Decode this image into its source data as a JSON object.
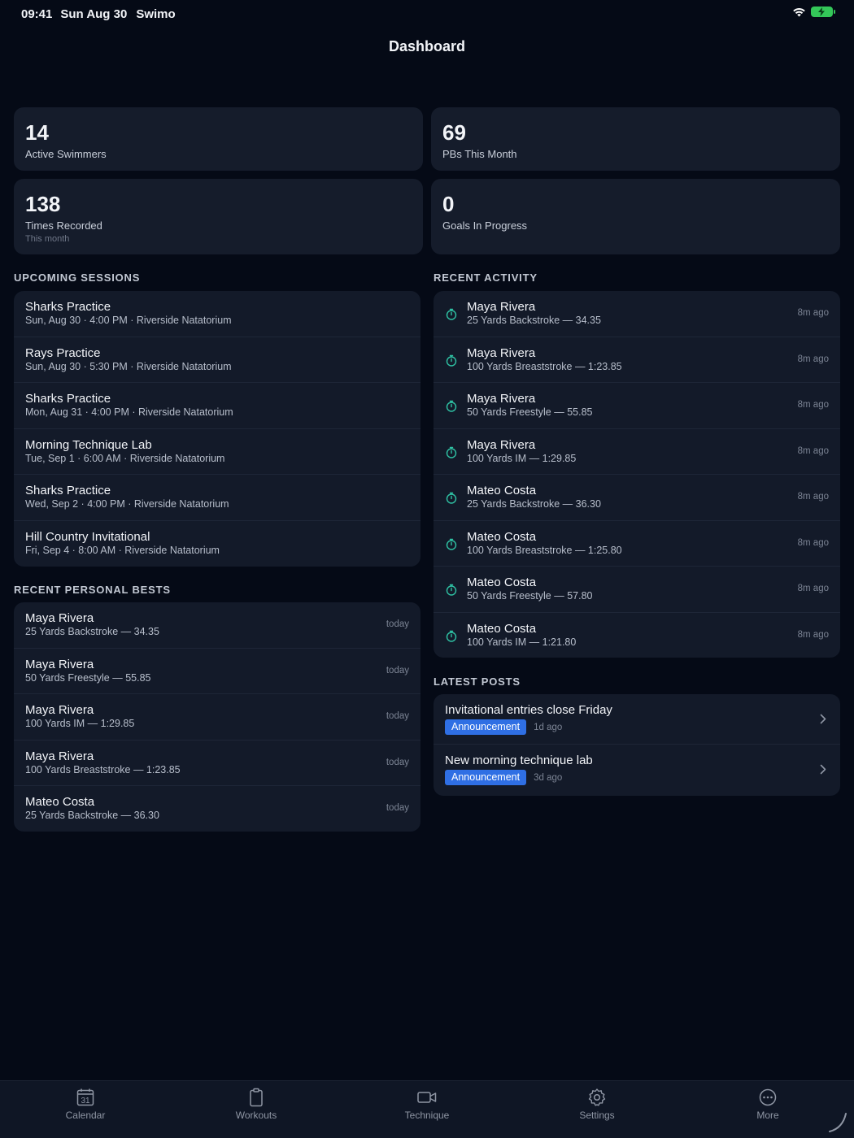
{
  "status_bar": {
    "time": "09:41",
    "date": "Sun Aug 30",
    "app_name": "Swimo"
  },
  "page": {
    "title": "Dashboard"
  },
  "stats": [
    {
      "value": "14",
      "label": "Active Swimmers",
      "sub": ""
    },
    {
      "value": "69",
      "label": "PBs This Month",
      "sub": ""
    },
    {
      "value": "138",
      "label": "Times Recorded",
      "sub": "This month"
    },
    {
      "value": "0",
      "label": "Goals In Progress",
      "sub": ""
    }
  ],
  "sections": {
    "upcoming_sessions": "UPCOMING SESSIONS",
    "recent_personal_bests": "RECENT PERSONAL BESTS",
    "recent_activity": "RECENT ACTIVITY",
    "latest_posts": "LATEST POSTS"
  },
  "upcoming_sessions": [
    {
      "title": "Sharks Practice",
      "detail": "Sun, Aug 30 · 4:00 PM · Riverside Natatorium"
    },
    {
      "title": "Rays Practice",
      "detail": "Sun, Aug 30 · 5:30 PM · Riverside Natatorium"
    },
    {
      "title": "Sharks Practice",
      "detail": "Mon, Aug 31 · 4:00 PM · Riverside Natatorium"
    },
    {
      "title": "Morning Technique Lab",
      "detail": "Tue, Sep 1 · 6:00 AM · Riverside Natatorium"
    },
    {
      "title": "Sharks Practice",
      "detail": "Wed, Sep 2 · 4:00 PM · Riverside Natatorium"
    },
    {
      "title": "Hill Country Invitational",
      "detail": "Fri, Sep 4 · 8:00 AM · Riverside Natatorium"
    }
  ],
  "recent_personal_bests": [
    {
      "name": "Maya Rivera",
      "detail": "25 Yards Backstroke — 34.35",
      "when": "today"
    },
    {
      "name": "Maya Rivera",
      "detail": "50 Yards Freestyle — 55.85",
      "when": "today"
    },
    {
      "name": "Maya Rivera",
      "detail": "100 Yards IM — 1:29.85",
      "when": "today"
    },
    {
      "name": "Maya Rivera",
      "detail": "100 Yards Breaststroke — 1:23.85",
      "when": "today"
    },
    {
      "name": "Mateo Costa",
      "detail": "25 Yards Backstroke — 36.30",
      "when": "today"
    }
  ],
  "recent_activity": [
    {
      "name": "Maya Rivera",
      "detail": "25 Yards Backstroke — 34.35",
      "when": "8m ago",
      "icon": "stopwatch-icon"
    },
    {
      "name": "Maya Rivera",
      "detail": "100 Yards Breaststroke — 1:23.85",
      "when": "8m ago",
      "icon": "stopwatch-icon"
    },
    {
      "name": "Maya Rivera",
      "detail": "50 Yards Freestyle — 55.85",
      "when": "8m ago",
      "icon": "stopwatch-icon"
    },
    {
      "name": "Maya Rivera",
      "detail": "100 Yards IM — 1:29.85",
      "when": "8m ago",
      "icon": "stopwatch-icon"
    },
    {
      "name": "Mateo Costa",
      "detail": "25 Yards Backstroke — 36.30",
      "when": "8m ago",
      "icon": "stopwatch-icon"
    },
    {
      "name": "Mateo Costa",
      "detail": "100 Yards Breaststroke — 1:25.80",
      "when": "8m ago",
      "icon": "stopwatch-icon"
    },
    {
      "name": "Mateo Costa",
      "detail": "50 Yards Freestyle — 57.80",
      "when": "8m ago",
      "icon": "stopwatch-icon"
    },
    {
      "name": "Mateo Costa",
      "detail": "100 Yards IM — 1:21.80",
      "when": "8m ago",
      "icon": "stopwatch-icon"
    }
  ],
  "latest_posts": [
    {
      "title": "Invitational entries close Friday",
      "tag": "Announcement",
      "when": "1d ago"
    },
    {
      "title": "New morning technique lab",
      "tag": "Announcement",
      "when": "3d ago"
    }
  ],
  "tab_bar": [
    {
      "label": "Calendar",
      "icon": "calendar-icon",
      "icon_text": "31"
    },
    {
      "label": "Workouts",
      "icon": "clipboard-icon"
    },
    {
      "label": "Technique",
      "icon": "video-camera-icon"
    },
    {
      "label": "Settings",
      "icon": "gear-icon"
    },
    {
      "label": "More",
      "icon": "more-icon"
    }
  ],
  "colors": {
    "background": "#050a16",
    "card": "#151c2b",
    "accent_badge": "#2f6fe4",
    "activity_icon": "#2fc2a4",
    "battery": "#34c759"
  }
}
